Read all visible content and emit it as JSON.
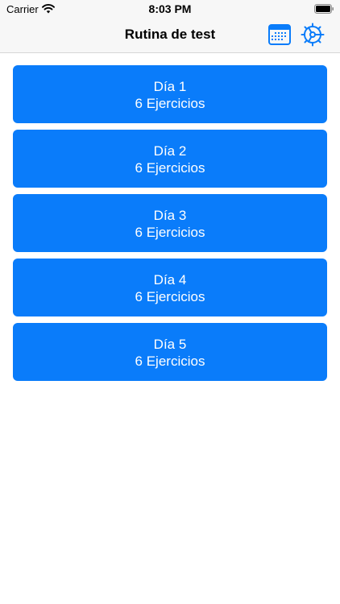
{
  "status_bar": {
    "carrier": "Carrier",
    "time": "8:03 PM",
    "wifi_icon": "wifi-icon",
    "battery_icon": "battery-full-icon"
  },
  "nav": {
    "title": "Rutina de test",
    "calendar_icon": "calendar-icon",
    "settings_icon": "gear-icon"
  },
  "colors": {
    "accent": "#0a7cfa",
    "card_text": "#ffffff",
    "nav_background": "#f7f7f7"
  },
  "days": [
    {
      "title": "Día 1",
      "count": "6 Ejercicios"
    },
    {
      "title": "Día 2",
      "count": "6 Ejercicios"
    },
    {
      "title": "Día 3",
      "count": "6 Ejercicios"
    },
    {
      "title": "Día 4",
      "count": "6 Ejercicios"
    },
    {
      "title": "Día 5",
      "count": "6 Ejercicios"
    }
  ]
}
